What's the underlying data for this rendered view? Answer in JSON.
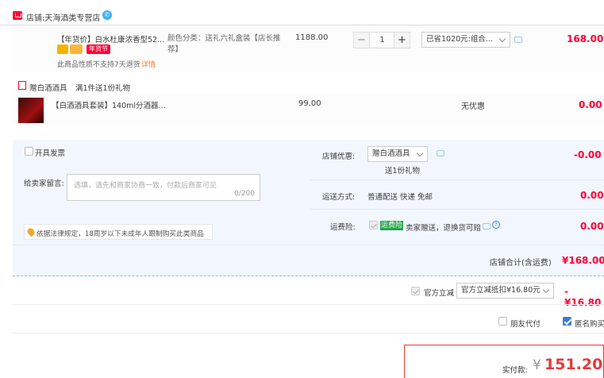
{
  "shop": {
    "label": "店铺:",
    "name": "天海酒类专营店"
  },
  "product1": {
    "title": "【年货价】白水杜康浓香型52...",
    "badge": "年货节",
    "notice": "此商品性质不支持7天退货",
    "detail_link": "详情",
    "sku": "颜色分类：送礼六礼盒装【店长推荐】",
    "unit_price": "1188.00",
    "quantity": "1",
    "minus": "−",
    "plus": "+",
    "discount_select": "已省1020元:组合...",
    "subtotal": "168.00"
  },
  "gift": {
    "header_label": "赠白酒酒具",
    "header_rule": "满1件送1份礼物",
    "title": "【白酒酒具套装】140ml分酒器...",
    "unit_price": "99.00",
    "discount": "无优惠",
    "subtotal": "0.00"
  },
  "order": {
    "invoice_label": "开具发票",
    "message_label": "给卖家留言:",
    "message_placeholder": "选填，请先和商家协商一致，付款后商家可见",
    "message_count": "0/200",
    "legal_notice": "依据法律规定，18周岁以下未成年人跟制购买此类商品",
    "shop_discount_label": "店铺优惠:",
    "shop_discount_select": "赠白酒酒具",
    "shop_discount_sub": "送1份礼物",
    "shop_discount_value": "-0.00",
    "shipping_label": "运送方式:",
    "shipping_value": "普通配送 快递 免邮",
    "shipping_price": "0.00",
    "insurance_label": "运费险:",
    "insurance_tag": "运费险",
    "insurance_desc": "卖家赠送，退换货可赔",
    "insurance_price": "0.00",
    "shop_total_label": "店铺合计(含运费)",
    "shop_total_value": "¥168.00"
  },
  "official": {
    "label": "官方立减",
    "select": "官方立减抵扣¥16.80元",
    "value": "-¥16.80"
  },
  "options": {
    "friend_pay": "朋友代付",
    "anonymous": "匿名购买"
  },
  "payment": {
    "label": "实付款:",
    "currency": "¥",
    "amount": "151.20"
  },
  "colors": {
    "accent": "#ff0036",
    "blue": "#3c7bd4",
    "area_bg": "#f2f7ff"
  }
}
